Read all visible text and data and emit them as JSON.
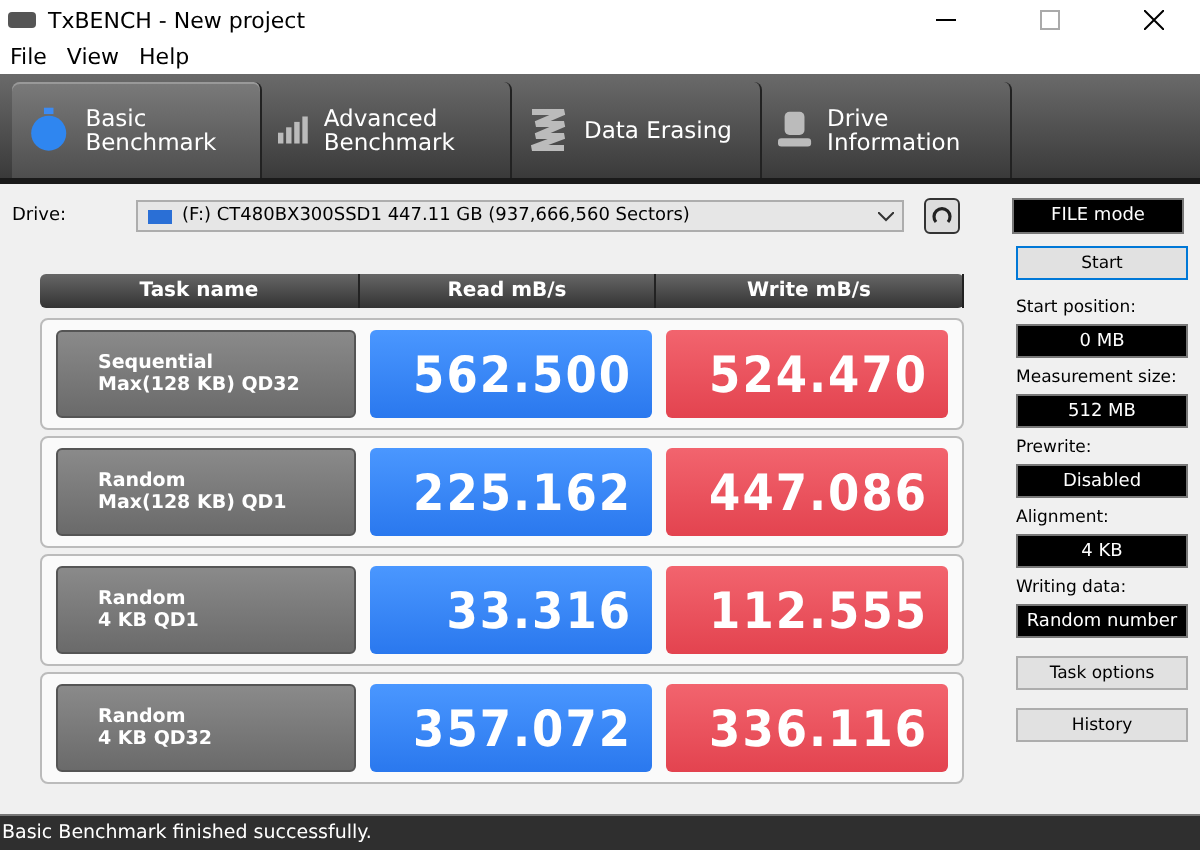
{
  "window": {
    "title": "TxBENCH - New project"
  },
  "menu": [
    "File",
    "View",
    "Help"
  ],
  "tabs": [
    {
      "label": "Basic Benchmark",
      "kind": "stopwatch",
      "selected": true
    },
    {
      "label": "Advanced Benchmark",
      "kind": "bars",
      "selected": false
    },
    {
      "label": "Data Erasing",
      "kind": "spring",
      "selected": false
    },
    {
      "label": "Drive Information",
      "kind": "drive",
      "selected": false
    }
  ],
  "drive": {
    "label": "Drive:",
    "value": "(F:) CT480BX300SSD1  447.11 GB (937,666,560 Sectors)"
  },
  "mode": "FILE mode",
  "table": {
    "columns": [
      "Task name",
      "Read mB/s",
      "Write mB/s"
    ],
    "rows": [
      {
        "task": [
          "Sequential",
          "Max(128 KB) QD32"
        ],
        "read": "562.500",
        "write": "524.470"
      },
      {
        "task": [
          "Random",
          "Max(128 KB) QD1"
        ],
        "read": "225.162",
        "write": "447.086"
      },
      {
        "task": [
          "Random",
          "4 KB QD1"
        ],
        "read": "33.316",
        "write": "112.555"
      },
      {
        "task": [
          "Random",
          "4 KB QD32"
        ],
        "read": "357.072",
        "write": "336.116"
      }
    ]
  },
  "side": {
    "start": "Start",
    "settings": [
      {
        "label": "Start position:",
        "value": "0 MB"
      },
      {
        "label": "Measurement size:",
        "value": "512 MB"
      },
      {
        "label": "Prewrite:",
        "value": "Disabled"
      },
      {
        "label": "Alignment:",
        "value": "4 KB"
      },
      {
        "label": "Writing data:",
        "value": "Random number"
      }
    ],
    "buttons": [
      "Task options",
      "History"
    ]
  },
  "status_bar": "Basic Benchmark finished successfully."
}
